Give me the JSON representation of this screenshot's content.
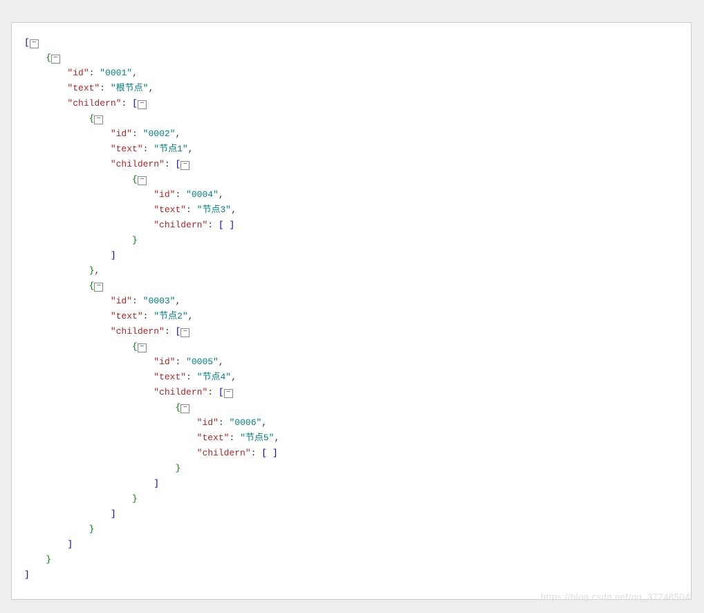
{
  "keys": {
    "id": "\"id\"",
    "text": "\"text\"",
    "childern": "\"childern\""
  },
  "vals": {
    "id_0001": "\"0001\"",
    "text_root": "\"根节点\"",
    "id_0002": "\"0002\"",
    "text_node1": "\"节点1\"",
    "id_0004": "\"0004\"",
    "text_node3": "\"节点3\"",
    "id_0003": "\"0003\"",
    "text_node2": "\"节点2\"",
    "id_0005": "\"0005\"",
    "text_node4": "\"节点4\"",
    "id_0006": "\"0006\"",
    "text_node5": "\"节点5\""
  },
  "toggle": "−",
  "watermark": "https://blog.csdn.net/qq_37248504"
}
